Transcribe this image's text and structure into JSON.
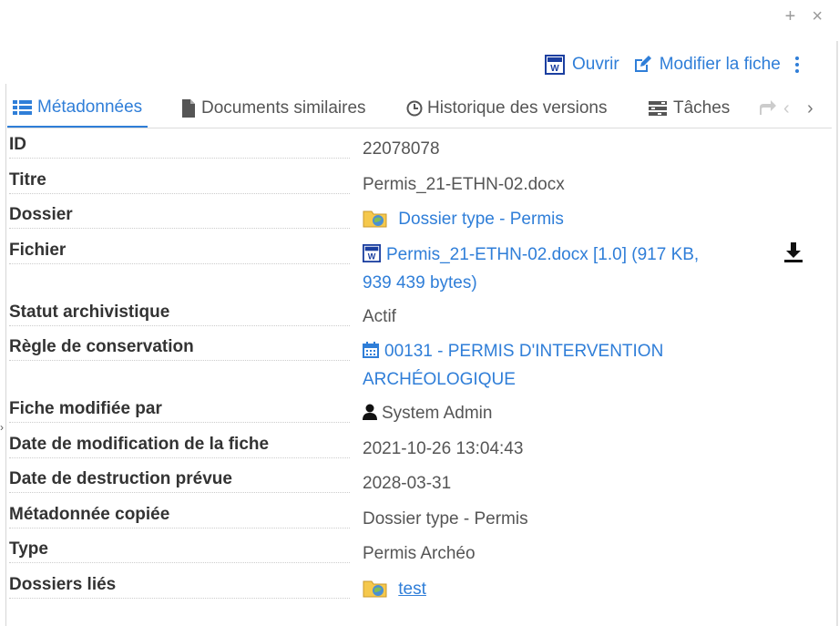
{
  "window_controls": {
    "add": "+",
    "close": "×"
  },
  "actions": {
    "open_label": "Ouvrir",
    "edit_label": "Modifier la fiche"
  },
  "tabs": [
    {
      "label": "Métadonnées",
      "active": true
    },
    {
      "label": "Documents similaires"
    },
    {
      "label": "Historique des versions"
    },
    {
      "label": "Tâches"
    }
  ],
  "metadata": {
    "id": {
      "label": "ID",
      "value": "22078078"
    },
    "title": {
      "label": "Titre",
      "value": "Permis_21-ETHN-02.docx"
    },
    "folder": {
      "label": "Dossier",
      "value": "Dossier type - Permis"
    },
    "file": {
      "label": "Fichier",
      "line1": "Permis_21-ETHN-02.docx [1.0] (917 KB,",
      "line2": "939 439 bytes)"
    },
    "archival_status": {
      "label": "Statut archivistique",
      "value": "Actif"
    },
    "retention_rule": {
      "label": "Règle de conservation",
      "line1": "00131 - PERMIS D'INTERVENTION",
      "line2": "ARCHÉOLOGIQUE"
    },
    "modified_by": {
      "label": "Fiche modifiée par",
      "value": "System Admin"
    },
    "modified_date": {
      "label": "Date de modification de la fiche",
      "value": "2021-10-26 13:04:43"
    },
    "destruction_date": {
      "label": "Date de destruction prévue",
      "value": "2028-03-31"
    },
    "copied_metadata": {
      "label": "Métadonnée copiée",
      "value": "Dossier type - Permis"
    },
    "type": {
      "label": "Type",
      "value": "Permis Archéo"
    },
    "linked_folders": {
      "label": "Dossiers liés",
      "value": "test"
    }
  },
  "colors": {
    "accent": "#2f7ed8",
    "text": "#333333",
    "muted": "#555555"
  }
}
